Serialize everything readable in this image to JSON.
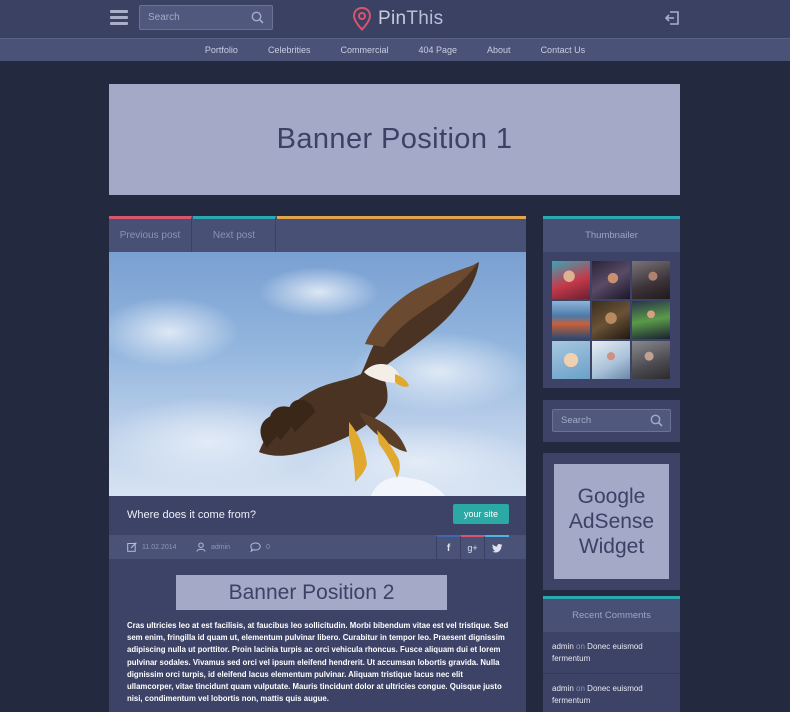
{
  "header": {
    "search_placeholder": "Search",
    "logo_text_a": "Pin",
    "logo_text_b": "This",
    "pin_color": "#d9546e"
  },
  "nav": {
    "items": [
      "Portfolio",
      "Celebrities",
      "Commercial",
      "404 Page",
      "About",
      "Contact Us"
    ]
  },
  "banners": {
    "top": "Banner Position 1",
    "inline": "Banner Position 2",
    "adsense": [
      "Google",
      "AdSense",
      "Widget"
    ]
  },
  "post_nav": {
    "previous": "Previous post",
    "next": "Next post"
  },
  "post": {
    "title": "Where does it come from?",
    "site_button": "your site",
    "date": "11.02.2014",
    "author": "admin",
    "comments": "0",
    "body": "Cras ultricies leo at est facilisis, at faucibus leo sollicitudin. Morbi bibendum vitae est vel tristique. Sed sem enim, fringilla id quam ut, elementum pulvinar libero. Curabitur in tempor leo. Praesent dignissim adipiscing nulla ut porttitor. Proin lacinia turpis ac orci vehicula rhoncus. Fusce aliquam dui et lorem pulvinar sodales. Vivamus sed orci vel ipsum eleifend hendrerit. Ut accumsan lobortis gravida. Nulla dignissim orci turpis, id eleifend lacus elementum pulvinar. Aliquam tristique lacus nec elit ullamcorper, vitae tincidunt quam vulputate. Mauris tincidunt dolor at ultricies congue. Quisque justo nisi, condimentum vel lobortis non, mattis quis augue."
  },
  "share": {
    "facebook": "f",
    "google": "g+",
    "twitter": "t"
  },
  "sidebar": {
    "thumbnailer_title": "Thumbnailer",
    "search_placeholder": "Search",
    "recent_comments_title": "Recent Comments",
    "comments": [
      {
        "author": "admin",
        "on": "on",
        "title": "Donec euismod fermentum"
      },
      {
        "author": "admin",
        "on": "on",
        "title": "Donec euismod fermentum"
      }
    ]
  },
  "colors": {
    "accent_red": "#d9546e",
    "accent_teal": "#2aa9b2",
    "accent_orange": "#e2a54a",
    "button_teal": "#2aa9a5"
  }
}
